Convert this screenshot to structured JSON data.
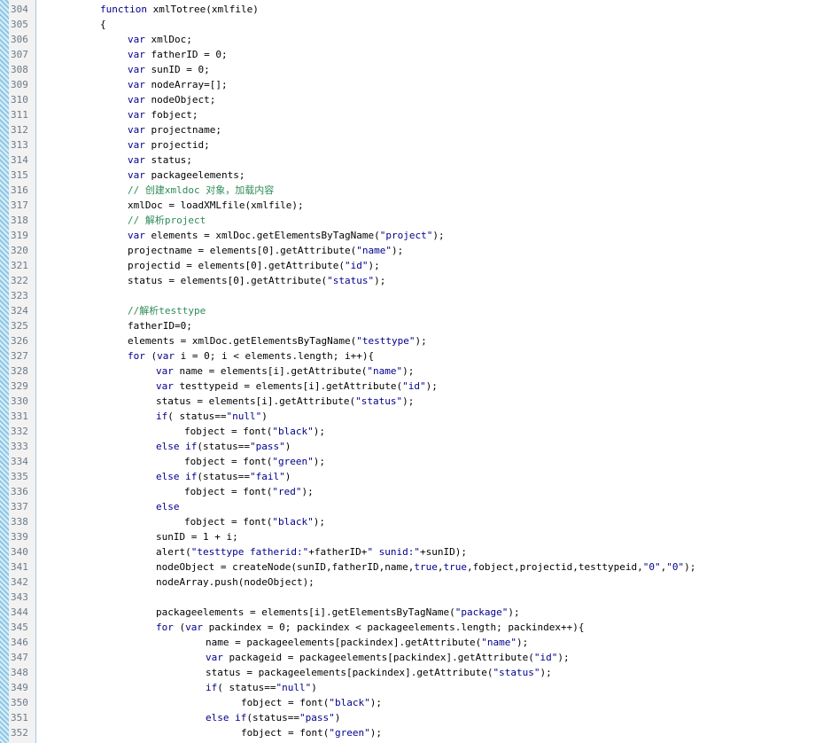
{
  "editor": {
    "colors": {
      "keyword": "#00008b",
      "string": "#00008b",
      "comment": "#2e8b57",
      "text": "#000000"
    },
    "lines": [
      {
        "n": "304",
        "indent": 0,
        "tokens": [
          [
            "kw",
            "function"
          ],
          [
            "p",
            " xmlTotree(xmlfile)"
          ]
        ]
      },
      {
        "n": "305",
        "indent": 0,
        "tokens": [
          [
            "p",
            "{"
          ]
        ]
      },
      {
        "n": "306",
        "indent": 1,
        "tokens": [
          [
            "kw",
            "var"
          ],
          [
            "p",
            " xmlDoc;"
          ]
        ]
      },
      {
        "n": "307",
        "indent": 1,
        "tokens": [
          [
            "kw",
            "var"
          ],
          [
            "p",
            " fatherID = 0;"
          ]
        ]
      },
      {
        "n": "308",
        "indent": 1,
        "tokens": [
          [
            "kw",
            "var"
          ],
          [
            "p",
            " sunID = 0;"
          ]
        ]
      },
      {
        "n": "309",
        "indent": 1,
        "tokens": [
          [
            "kw",
            "var"
          ],
          [
            "p",
            " nodeArray=[];"
          ]
        ]
      },
      {
        "n": "310",
        "indent": 1,
        "tokens": [
          [
            "kw",
            "var"
          ],
          [
            "p",
            " nodeObject;"
          ]
        ]
      },
      {
        "n": "311",
        "indent": 1,
        "tokens": [
          [
            "kw",
            "var"
          ],
          [
            "p",
            " fobject;"
          ]
        ]
      },
      {
        "n": "312",
        "indent": 1,
        "tokens": [
          [
            "kw",
            "var"
          ],
          [
            "p",
            " projectname;"
          ]
        ]
      },
      {
        "n": "313",
        "indent": 1,
        "tokens": [
          [
            "kw",
            "var"
          ],
          [
            "p",
            " projectid;"
          ]
        ]
      },
      {
        "n": "314",
        "indent": 1,
        "tokens": [
          [
            "kw",
            "var"
          ],
          [
            "p",
            " status;"
          ]
        ]
      },
      {
        "n": "315",
        "indent": 1,
        "tokens": [
          [
            "kw",
            "var"
          ],
          [
            "p",
            " packageelements;"
          ]
        ]
      },
      {
        "n": "316",
        "indent": 1,
        "tokens": [
          [
            "cm",
            "// 创建xmldoc 对象，加载内容"
          ]
        ]
      },
      {
        "n": "317",
        "indent": 1,
        "tokens": [
          [
            "p",
            "xmlDoc = loadXMLfile(xmlfile);"
          ]
        ]
      },
      {
        "n": "318",
        "indent": 1,
        "tokens": [
          [
            "cm",
            "// 解析project"
          ]
        ]
      },
      {
        "n": "319",
        "indent": 1,
        "tokens": [
          [
            "kw",
            "var"
          ],
          [
            "p",
            " elements = xmlDoc.getElementsByTagName("
          ],
          [
            "str",
            "\"project\""
          ],
          [
            "p",
            ");"
          ]
        ]
      },
      {
        "n": "320",
        "indent": 1,
        "tokens": [
          [
            "p",
            "projectname = elements[0].getAttribute("
          ],
          [
            "str",
            "\"name\""
          ],
          [
            "p",
            ");"
          ]
        ]
      },
      {
        "n": "321",
        "indent": 1,
        "tokens": [
          [
            "p",
            "projectid = elements[0].getAttribute("
          ],
          [
            "str",
            "\"id\""
          ],
          [
            "p",
            ");"
          ]
        ]
      },
      {
        "n": "322",
        "indent": 1,
        "tokens": [
          [
            "p",
            "status = elements[0].getAttribute("
          ],
          [
            "str",
            "\"status\""
          ],
          [
            "p",
            ");"
          ]
        ]
      },
      {
        "n": "323",
        "indent": 0,
        "tokens": []
      },
      {
        "n": "324",
        "indent": 1,
        "tokens": [
          [
            "cm",
            "//解析testtype"
          ]
        ]
      },
      {
        "n": "325",
        "indent": 1,
        "tokens": [
          [
            "p",
            "fatherID=0;"
          ]
        ]
      },
      {
        "n": "326",
        "indent": 1,
        "tokens": [
          [
            "p",
            "elements = xmlDoc.getElementsByTagName("
          ],
          [
            "str",
            "\"testtype\""
          ],
          [
            "p",
            ");"
          ]
        ]
      },
      {
        "n": "327",
        "indent": 1,
        "tokens": [
          [
            "kw",
            "for"
          ],
          [
            "p",
            " ("
          ],
          [
            "kw",
            "var"
          ],
          [
            "p",
            " i = 0; i < elements.length; i++){"
          ]
        ]
      },
      {
        "n": "328",
        "indent": 2,
        "tokens": [
          [
            "kw",
            "var"
          ],
          [
            "p",
            " name = elements[i].getAttribute("
          ],
          [
            "str",
            "\"name\""
          ],
          [
            "p",
            ");"
          ]
        ]
      },
      {
        "n": "329",
        "indent": 2,
        "tokens": [
          [
            "kw",
            "var"
          ],
          [
            "p",
            " testtypeid = elements[i].getAttribute("
          ],
          [
            "str",
            "\"id\""
          ],
          [
            "p",
            ");"
          ]
        ]
      },
      {
        "n": "330",
        "indent": 2,
        "tokens": [
          [
            "p",
            "status = elements[i].getAttribute("
          ],
          [
            "str",
            "\"status\""
          ],
          [
            "p",
            ");"
          ]
        ]
      },
      {
        "n": "331",
        "indent": 2,
        "tokens": [
          [
            "kw",
            "if"
          ],
          [
            "p",
            "( status=="
          ],
          [
            "str",
            "\"null\""
          ],
          [
            "p",
            ")"
          ]
        ]
      },
      {
        "n": "332",
        "indent": 3,
        "tokens": [
          [
            "p",
            "fobject = font("
          ],
          [
            "str",
            "\"black\""
          ],
          [
            "p",
            ");"
          ]
        ]
      },
      {
        "n": "333",
        "indent": 2,
        "tokens": [
          [
            "kw",
            "else if"
          ],
          [
            "p",
            "(status=="
          ],
          [
            "str",
            "\"pass\""
          ],
          [
            "p",
            ")"
          ]
        ]
      },
      {
        "n": "334",
        "indent": 3,
        "tokens": [
          [
            "p",
            "fobject = font("
          ],
          [
            "str",
            "\"green\""
          ],
          [
            "p",
            ");"
          ]
        ]
      },
      {
        "n": "335",
        "indent": 2,
        "tokens": [
          [
            "kw",
            "else if"
          ],
          [
            "p",
            "(status=="
          ],
          [
            "str",
            "\"fail\""
          ],
          [
            "p",
            ")"
          ]
        ]
      },
      {
        "n": "336",
        "indent": 3,
        "tokens": [
          [
            "p",
            "fobject = font("
          ],
          [
            "str",
            "\"red\""
          ],
          [
            "p",
            ");"
          ]
        ]
      },
      {
        "n": "337",
        "indent": 2,
        "tokens": [
          [
            "kw",
            "else"
          ]
        ]
      },
      {
        "n": "338",
        "indent": 3,
        "tokens": [
          [
            "p",
            "fobject = font("
          ],
          [
            "str",
            "\"black\""
          ],
          [
            "p",
            ");"
          ]
        ]
      },
      {
        "n": "339",
        "indent": 2,
        "tokens": [
          [
            "p",
            "sunID = 1 + i;"
          ]
        ]
      },
      {
        "n": "340",
        "indent": 2,
        "tokens": [
          [
            "p",
            "alert("
          ],
          [
            "str",
            "\"testtype fatherid:\""
          ],
          [
            "p",
            "+fatherID+"
          ],
          [
            "str",
            "\" sunid:\""
          ],
          [
            "p",
            "+sunID);"
          ]
        ]
      },
      {
        "n": "341",
        "indent": 2,
        "tokens": [
          [
            "p",
            "nodeObject = createNode(sunID,fatherID,name,"
          ],
          [
            "kw",
            "true"
          ],
          [
            "p",
            ","
          ],
          [
            "kw",
            "true"
          ],
          [
            "p",
            ",fobject,projectid,testtypeid,"
          ],
          [
            "str",
            "\"0\""
          ],
          [
            "p",
            ","
          ],
          [
            "str",
            "\"0\""
          ],
          [
            "p",
            ");"
          ]
        ]
      },
      {
        "n": "342",
        "indent": 2,
        "tokens": [
          [
            "p",
            "nodeArray.push(nodeObject);"
          ]
        ]
      },
      {
        "n": "343",
        "indent": 0,
        "tokens": []
      },
      {
        "n": "344",
        "indent": 2,
        "tokens": [
          [
            "p",
            "packageelements = elements[i].getElementsByTagName("
          ],
          [
            "str",
            "\"package\""
          ],
          [
            "p",
            ");"
          ]
        ]
      },
      {
        "n": "345",
        "indent": 2,
        "tokens": [
          [
            "kw",
            "for"
          ],
          [
            "p",
            " ("
          ],
          [
            "kw",
            "var"
          ],
          [
            "p",
            " packindex = 0; packindex < packageelements.length; packindex++){"
          ]
        ]
      },
      {
        "n": "346",
        "indent": 4,
        "tokens": [
          [
            "p",
            "name = packageelements[packindex].getAttribute("
          ],
          [
            "str",
            "\"name\""
          ],
          [
            "p",
            ");"
          ]
        ]
      },
      {
        "n": "347",
        "indent": 4,
        "tokens": [
          [
            "kw",
            "var"
          ],
          [
            "p",
            " packageid = packageelements[packindex].getAttribute("
          ],
          [
            "str",
            "\"id\""
          ],
          [
            "p",
            ");"
          ]
        ]
      },
      {
        "n": "348",
        "indent": 4,
        "tokens": [
          [
            "p",
            "status = packageelements[packindex].getAttribute("
          ],
          [
            "str",
            "\"status\""
          ],
          [
            "p",
            ");"
          ]
        ]
      },
      {
        "n": "349",
        "indent": 4,
        "tokens": [
          [
            "kw",
            "if"
          ],
          [
            "p",
            "( status=="
          ],
          [
            "str",
            "\"null\""
          ],
          [
            "p",
            ")"
          ]
        ]
      },
      {
        "n": "350",
        "indent": 5,
        "tokens": [
          [
            "p",
            "fobject = font("
          ],
          [
            "str",
            "\"black\""
          ],
          [
            "p",
            ");"
          ]
        ]
      },
      {
        "n": "351",
        "indent": 4,
        "tokens": [
          [
            "kw",
            "else if"
          ],
          [
            "p",
            "(status=="
          ],
          [
            "str",
            "\"pass\""
          ],
          [
            "p",
            ")"
          ]
        ]
      },
      {
        "n": "352",
        "indent": 5,
        "tokens": [
          [
            "p",
            "fobject = font("
          ],
          [
            "str",
            "\"green\""
          ],
          [
            "p",
            ");"
          ]
        ]
      }
    ]
  }
}
